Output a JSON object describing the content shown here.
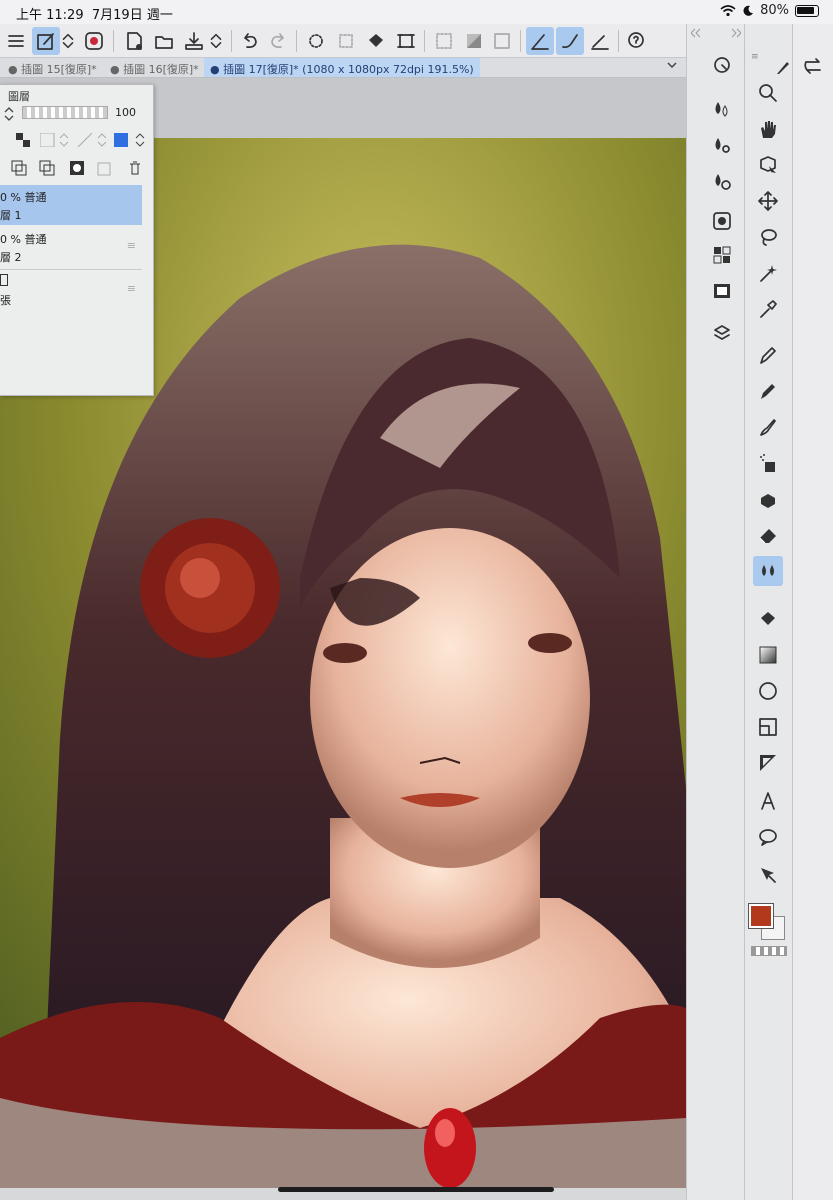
{
  "status": {
    "time": "上午 11:29",
    "date": "7月19日 週一",
    "battery": "80%"
  },
  "tabs": [
    {
      "label": "插圖 15[復原]*"
    },
    {
      "label": "插圖 16[復原]*"
    },
    {
      "label": "插圖 17[復原]* (1080 x 1080px 72dpi 191.5%)"
    }
  ],
  "layer_panel": {
    "title": "圖層",
    "opacity": "100",
    "layers": [
      {
        "mode": "0 % 普通",
        "name": "層 1"
      },
      {
        "mode": "0 % 普通",
        "name": "層 2"
      },
      {
        "mode": "",
        "name": "張"
      }
    ]
  },
  "colors": {
    "main": "#b3391c",
    "sub": "#f4f4f4",
    "accent": "#a9c9ef"
  },
  "tools": {
    "palette": [
      "rotate-view-icon",
      "layer-property-icon",
      "sub-tool-icon",
      "tool-property-icon",
      "navigator-icon",
      "color-set-icon",
      "animation-icon",
      "material-icon"
    ],
    "toolbox": [
      "zoom-icon",
      "hand-icon",
      "object-icon",
      "move-icon",
      "lasso-icon",
      "magic-wand-icon",
      "eyedropper-icon",
      "pen-icon",
      "pencil-icon",
      "brush-icon",
      "airbrush-icon",
      "decoration-icon",
      "eraser-icon",
      "blend-icon",
      "fill-icon",
      "gradient-icon",
      "figure-icon",
      "frame-icon",
      "ruler-icon",
      "text-icon",
      "balloon-icon",
      "correct-line-icon"
    ]
  }
}
